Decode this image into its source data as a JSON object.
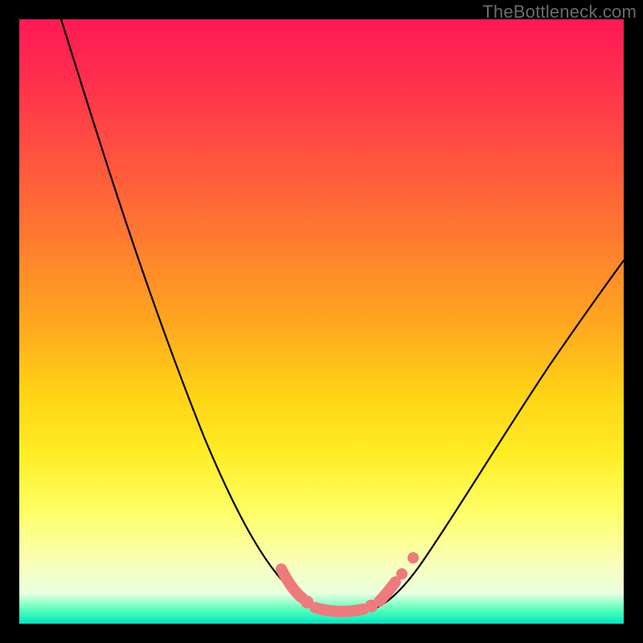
{
  "watermark": "TheBottleneck.com",
  "colors": {
    "frame_background_top": "#ff1a54",
    "frame_background_bottom": "#00e4c0",
    "page_background": "#000000",
    "curve": "#000000",
    "bead": "#ef7a7c",
    "watermark_text": "#6b6b6b"
  },
  "chart_data": {
    "type": "line",
    "title": "",
    "xlabel": "",
    "ylabel": "",
    "xlim": [
      0,
      100
    ],
    "ylim": [
      0,
      100
    ],
    "grid": false,
    "legend": false,
    "series": [
      {
        "name": "curve",
        "x": [
          0,
          5,
          10,
          15,
          20,
          25,
          30,
          35,
          40,
          45,
          48,
          50,
          52,
          55,
          58,
          62,
          68,
          75,
          82,
          90,
          100
        ],
        "y": [
          100,
          90,
          79,
          68,
          56,
          45,
          34,
          24,
          15,
          7,
          3,
          1,
          1,
          3,
          7,
          14,
          24,
          35,
          45,
          54,
          63
        ],
        "note": "V-shaped curve; y≈0 is the flat bottom around x≈50–55; values estimated from pixels"
      }
    ],
    "annotations": {
      "beads_along_bottom": true,
      "bead_color": "#ef7a7c"
    }
  }
}
